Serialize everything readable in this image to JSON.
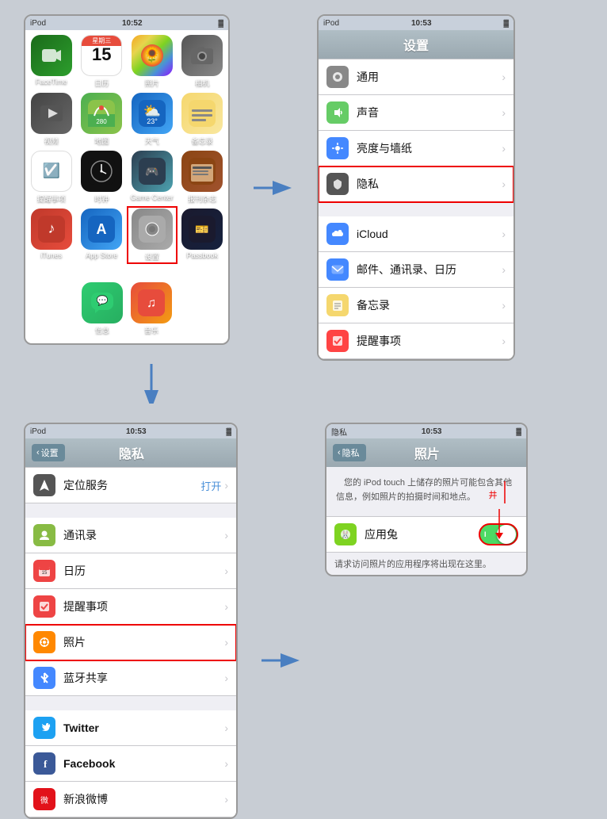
{
  "top_left_phone": {
    "status_bar": {
      "left": "iPod",
      "center": "10:52",
      "right": "■■■"
    },
    "apps": [
      {
        "id": "facetime",
        "label": "FaceTime",
        "icon": "📷",
        "class": "app-facetime"
      },
      {
        "id": "calendar",
        "label": "日历",
        "icon": "15",
        "class": "app-calendar"
      },
      {
        "id": "photos",
        "label": "照片",
        "icon": "🌻",
        "class": "app-photos"
      },
      {
        "id": "camera",
        "label": "相机",
        "icon": "📸",
        "class": "app-camera"
      },
      {
        "id": "videos",
        "label": "视频",
        "icon": "▶",
        "class": "app-videos"
      },
      {
        "id": "maps",
        "label": "地图",
        "icon": "📍",
        "class": "app-maps"
      },
      {
        "id": "weather",
        "label": "天气",
        "icon": "⛅",
        "class": "app-weather"
      },
      {
        "id": "notes",
        "label": "备忘录",
        "icon": "📝",
        "class": "app-notes"
      },
      {
        "id": "reminders",
        "label": "提醒事项",
        "icon": "☑",
        "class": "app-reminders"
      },
      {
        "id": "clock",
        "label": "时钟",
        "icon": "🕐",
        "class": "app-clock"
      },
      {
        "id": "gamecenter",
        "label": "Game Center",
        "icon": "🎮",
        "class": "app-gamecenter"
      },
      {
        "id": "newsstand",
        "label": "报刊杂志",
        "icon": "📰",
        "class": "app-newsstand"
      },
      {
        "id": "itunes",
        "label": "iTunes",
        "icon": "♪",
        "class": "app-itunes"
      },
      {
        "id": "appstore",
        "label": "App Store",
        "icon": "A",
        "class": "app-appstore"
      },
      {
        "id": "settings",
        "label": "设置",
        "icon": "⚙",
        "class": "app-settings",
        "highlight": true
      },
      {
        "id": "passbook",
        "label": "Passbook",
        "icon": "🎫",
        "class": "app-passbook"
      },
      {
        "id": "messages",
        "label": "信息",
        "icon": "💬",
        "class": "app-messages"
      },
      {
        "id": "music",
        "label": "音乐",
        "icon": "♫",
        "class": "app-music"
      }
    ]
  },
  "top_right_phone": {
    "status_bar": {
      "left": "iPod",
      "center": "10:53"
    },
    "title": "设置",
    "items": [
      {
        "id": "general",
        "label": "通用",
        "icon_color": "#888",
        "icon": "⚙"
      },
      {
        "id": "sound",
        "label": "声音",
        "icon_color": "#6c6",
        "icon": "🔔"
      },
      {
        "id": "brightness",
        "label": "亮度与墙纸",
        "icon_color": "#48f",
        "icon": "☀"
      },
      {
        "id": "privacy",
        "label": "隐私",
        "icon_color": "#555",
        "icon": "✋",
        "highlight": true
      },
      {
        "id": "icloud",
        "label": "iCloud",
        "icon_color": "#48f",
        "icon": "☁"
      },
      {
        "id": "mail",
        "label": "邮件、通讯录、日历",
        "icon_color": "#48f",
        "icon": "✉"
      },
      {
        "id": "notes2",
        "label": "备忘录",
        "icon_color": "#f5c",
        "icon": "📝"
      },
      {
        "id": "reminders2",
        "label": "提醒事项",
        "icon_color": "#f44",
        "icon": "☑"
      }
    ]
  },
  "bottom_left_phone": {
    "status_bar": {
      "left": "iPod",
      "center": "10:53"
    },
    "back_label": "设置",
    "title": "隐私",
    "items": [
      {
        "id": "location",
        "label": "定位服务",
        "open_label": "打开",
        "icon_color": "#555",
        "icon": "✈"
      },
      {
        "id": "contacts",
        "label": "通讯录",
        "icon_color": "#8b4",
        "icon": "👤"
      },
      {
        "id": "calendar2",
        "label": "日历",
        "icon_color": "#e44",
        "icon": "📅"
      },
      {
        "id": "reminders3",
        "label": "提醒事项",
        "icon_color": "#e44",
        "icon": "☑"
      },
      {
        "id": "photos2",
        "label": "照片",
        "icon_color": "#f80",
        "icon": "🌻",
        "highlight": true
      },
      {
        "id": "bluetooth",
        "label": "蓝牙共享",
        "icon_color": "#48f",
        "icon": "✦"
      },
      {
        "id": "twitter",
        "label": "Twitter",
        "icon_color": "#1da1f2",
        "icon": "T"
      },
      {
        "id": "facebook",
        "label": "Facebook",
        "icon_color": "#3b5998",
        "icon": "f"
      },
      {
        "id": "weibo",
        "label": "新浪微博",
        "icon_color": "#e2121a",
        "icon": "微"
      }
    ]
  },
  "bottom_right_phone": {
    "status_bar": {
      "left": "隐私",
      "center": "10:53"
    },
    "back_label": "隐私",
    "title": "照片",
    "description": "您的 iPod touch 上储存的照片可能包含其他信息，例如照片的拍摄时间和地点。",
    "toggle_label": "应用兔",
    "toggle_state": "on",
    "note": "请求访问照片的应用程序将出现在这里。",
    "annotation_text": "井"
  },
  "arrows": {
    "right": "→",
    "down": "↓"
  }
}
